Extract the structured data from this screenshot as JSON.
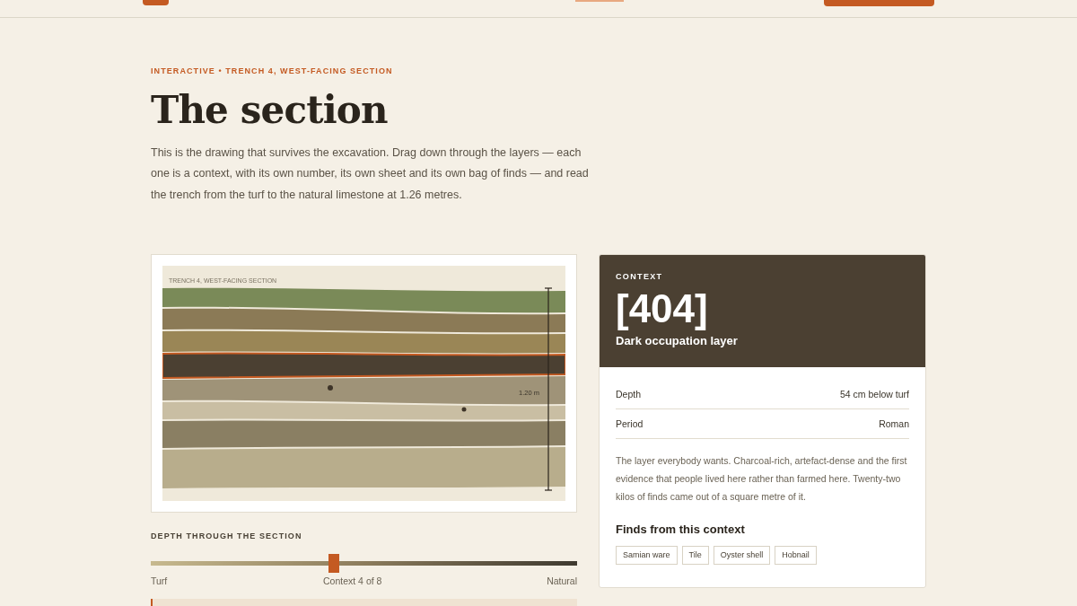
{
  "eyebrow": "INTERACTIVE • TRENCH 4, WEST-FACING SECTION",
  "title": "The section",
  "intro": "This is the drawing that survives the excavation. Drag down through the layers — each one is a context, with its own number, its own sheet and its own bag of finds — and read the trench from the turf to the natural limestone at 1.26 metres.",
  "section": {
    "caption": "TRENCH 4, WEST-FACING SECTION",
    "scale_label": "1.20 m",
    "layers": [
      {
        "color": "#7a8a58",
        "selected": false
      },
      {
        "color": "#8b7a56",
        "selected": false
      },
      {
        "color": "#9a8656",
        "selected": false
      },
      {
        "color": "#4b4032",
        "selected": true
      },
      {
        "color": "#9f9378",
        "selected": false
      },
      {
        "color": "#c9bea3",
        "selected": false
      },
      {
        "color": "#8a7f63",
        "selected": false
      },
      {
        "color": "#b8ad8c",
        "selected": false
      }
    ]
  },
  "slider": {
    "label": "DEPTH THROUGH THE SECTION",
    "level": 0.43,
    "start": "Turf",
    "reading": "Context 4 of 8",
    "end": "Natural"
  },
  "context": {
    "eyebrow": "CONTEXT",
    "number": "[404]",
    "name": "Dark occupation layer",
    "facts": [
      {
        "label": "Depth",
        "value": "54 cm below turf"
      },
      {
        "label": "Period",
        "value": "Roman"
      }
    ],
    "description": "The layer everybody wants. Charcoal-rich, artefact-dense and the first evidence that people lived here rather than farmed here. Twenty-two kilos of finds came out of a square metre of it.",
    "finds_heading": "Finds from this context",
    "finds": [
      "Samian ware",
      "Tile",
      "Oyster shell",
      "Hobnail"
    ]
  }
}
